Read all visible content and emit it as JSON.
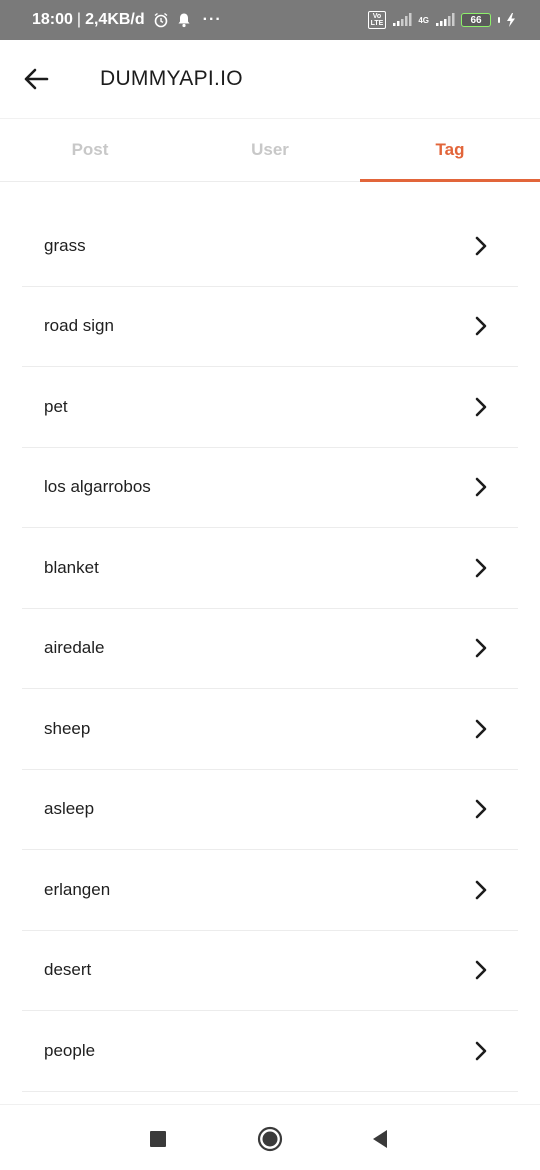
{
  "status_bar": {
    "time": "18:00",
    "separator": "|",
    "speed": "2,4KB/d",
    "more": "···",
    "volte_top": "Vo",
    "volte_bottom": "LTE",
    "network": "4G",
    "battery": "66"
  },
  "app_bar": {
    "title": "DUMMYAPI.IO"
  },
  "tabs": [
    {
      "label": "Post",
      "active": false
    },
    {
      "label": "User",
      "active": false
    },
    {
      "label": "Tag",
      "active": true
    }
  ],
  "tags": [
    {
      "label": "grass"
    },
    {
      "label": "road sign"
    },
    {
      "label": "pet"
    },
    {
      "label": "los algarrobos"
    },
    {
      "label": "blanket"
    },
    {
      "label": "airedale"
    },
    {
      "label": "sheep"
    },
    {
      "label": "asleep"
    },
    {
      "label": "erlangen"
    },
    {
      "label": "desert"
    },
    {
      "label": "people"
    }
  ],
  "colors": {
    "accent": "#e2653a",
    "inactive_tab": "#c8c8c8",
    "status_bar": "#7a7a7a"
  },
  "icons": {
    "back": "arrow-left-icon",
    "row": "chevron-right-icon",
    "nav_recents": "square-icon",
    "nav_home": "circle-icon",
    "nav_back": "triangle-left-icon"
  }
}
